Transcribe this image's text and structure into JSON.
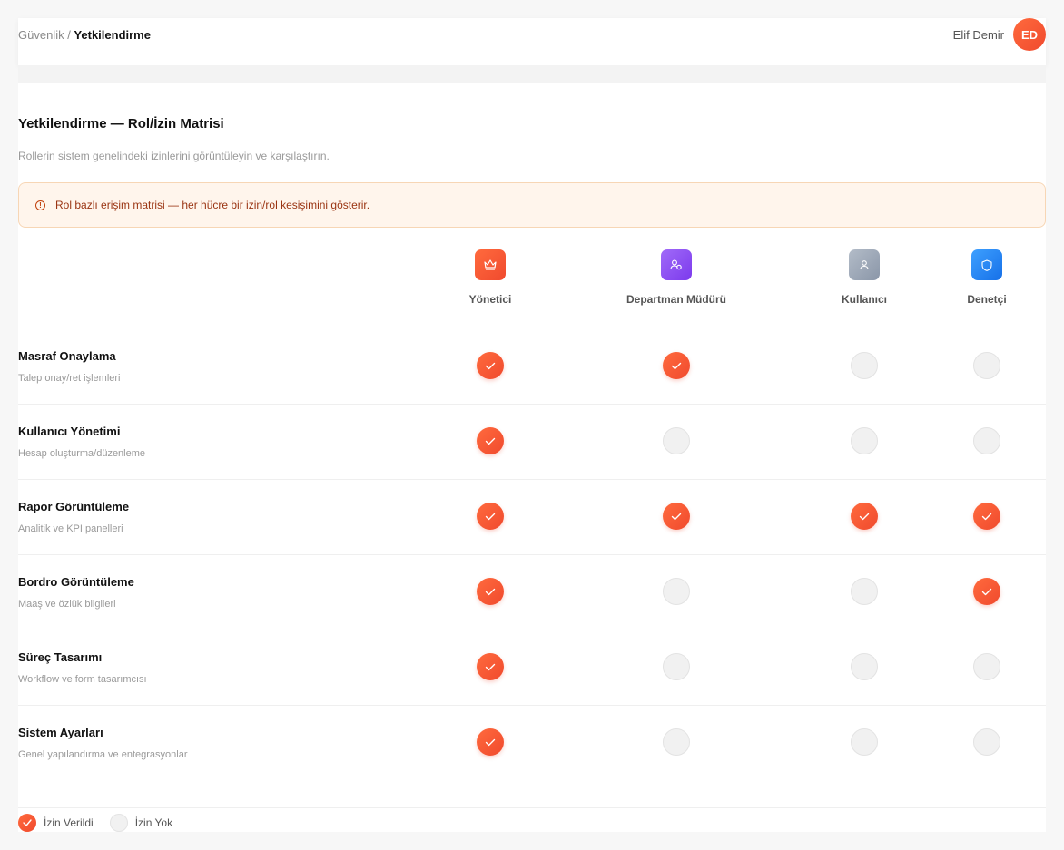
{
  "breadcrumb": {
    "parent": "Güvenlik /",
    "current": "Yetkilendirme"
  },
  "user": {
    "name": "Elif Demir",
    "initials": "ED"
  },
  "page": {
    "title": "Yetkilendirme — Rol/İzin Matrisi",
    "subtitle": "Rollerin sistem genelindeki izinlerini görüntüleyin ve karşılaştırın."
  },
  "alert": {
    "icon": "info-icon",
    "text": "Rol bazlı erişim matrisi — her hücre bir izin/rol kesişimini gösterir."
  },
  "colors": {
    "accent": "#f4532e",
    "role_admin": "#f4532e",
    "role_manager": "#8b5cf6",
    "role_user": "#94a3b8",
    "role_auditor": "#1d8cf8",
    "alert_bg": "#fff5ec"
  },
  "roles": [
    {
      "label": "Yönetici",
      "icon": "crown-icon"
    },
    {
      "label": "Departman Müdürü",
      "icon": "users-icon"
    },
    {
      "label": "Kullanıcı",
      "icon": "user-icon"
    },
    {
      "label": "Denetçi",
      "icon": "shield-icon"
    }
  ],
  "permissions": [
    {
      "name": "Masraf Onaylama",
      "desc": "Talep onay/ret işlemleri",
      "grants": [
        true,
        true,
        false,
        false
      ]
    },
    {
      "name": "Kullanıcı Yönetimi",
      "desc": "Hesap oluşturma/düzenleme",
      "grants": [
        true,
        false,
        false,
        false
      ]
    },
    {
      "name": "Rapor Görüntüleme",
      "desc": "Analitik ve KPI panelleri",
      "grants": [
        true,
        true,
        true,
        true
      ]
    },
    {
      "name": "Bordro Görüntüleme",
      "desc": "Maaş ve özlük bilgileri",
      "grants": [
        true,
        false,
        false,
        true
      ]
    },
    {
      "name": "Süreç Tasarımı",
      "desc": "Workflow ve form tasarımcısı",
      "grants": [
        true,
        false,
        false,
        false
      ]
    },
    {
      "name": "Sistem Ayarları",
      "desc": "Genel yapılandırma ve entegrasyonlar",
      "grants": [
        true,
        false,
        false,
        false
      ]
    }
  ],
  "legend": {
    "granted": "İzin Verildi",
    "denied": "İzin Yok"
  }
}
